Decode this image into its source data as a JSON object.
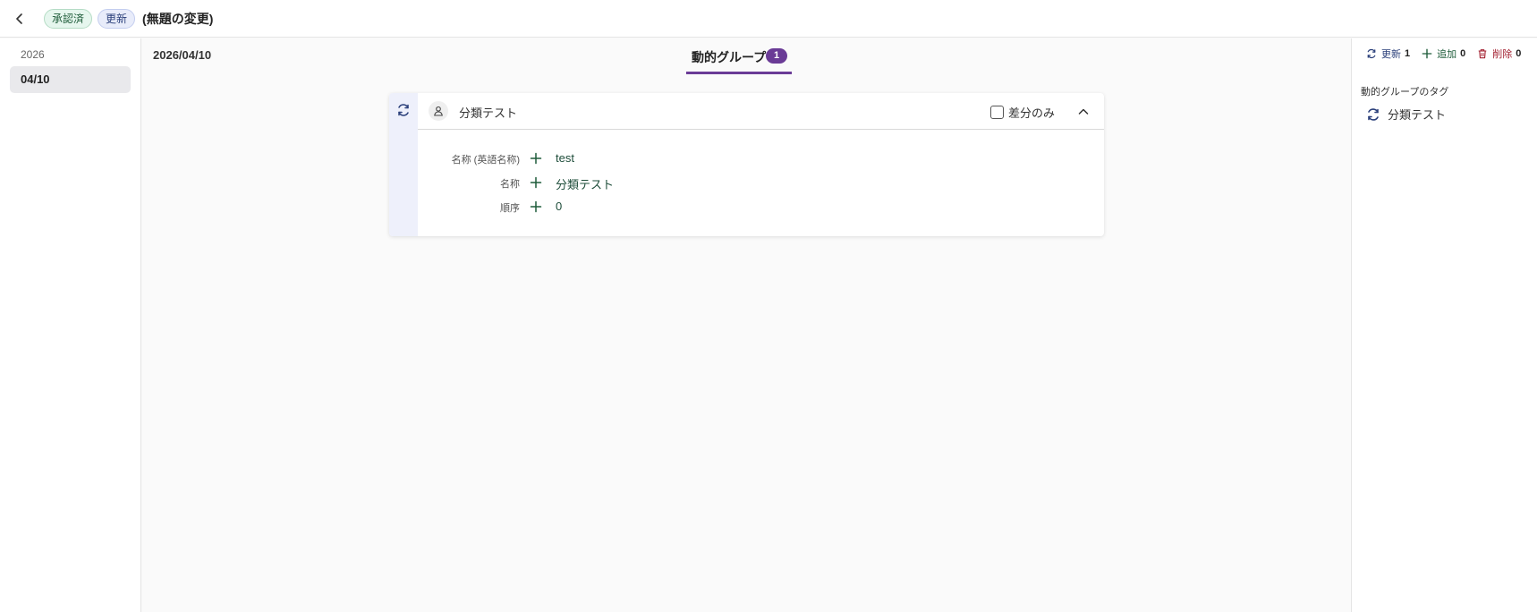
{
  "header": {
    "badges": {
      "approved": "承認済",
      "update": "更新"
    },
    "title": "(無題の変更)"
  },
  "sidebar": {
    "year": "2026",
    "selected_date": "04/10"
  },
  "main": {
    "date": "2026/04/10",
    "tab": {
      "label": "動的グループ",
      "count": "1"
    },
    "card": {
      "name": "分類テスト",
      "diff_only_label": "差分のみ",
      "diff_only_checked": false,
      "fields": [
        {
          "label": "名称 (英語名称)",
          "value": "test"
        },
        {
          "label": "名称",
          "value": "分類テスト"
        },
        {
          "label": "順序",
          "value": "0"
        }
      ]
    }
  },
  "right_panel": {
    "stats": {
      "update_label": "更新",
      "update_count": "1",
      "add_label": "追加",
      "add_count": "0",
      "delete_label": "削除",
      "delete_count": "0"
    },
    "tag_heading": "動的グループのタグ",
    "tag_item": "分類テスト"
  },
  "colors": {
    "accent_purple": "#6a3b96",
    "update_blue": "#2a3f7a",
    "add_green": "#1e5c3a",
    "delete_red": "#a32232"
  }
}
